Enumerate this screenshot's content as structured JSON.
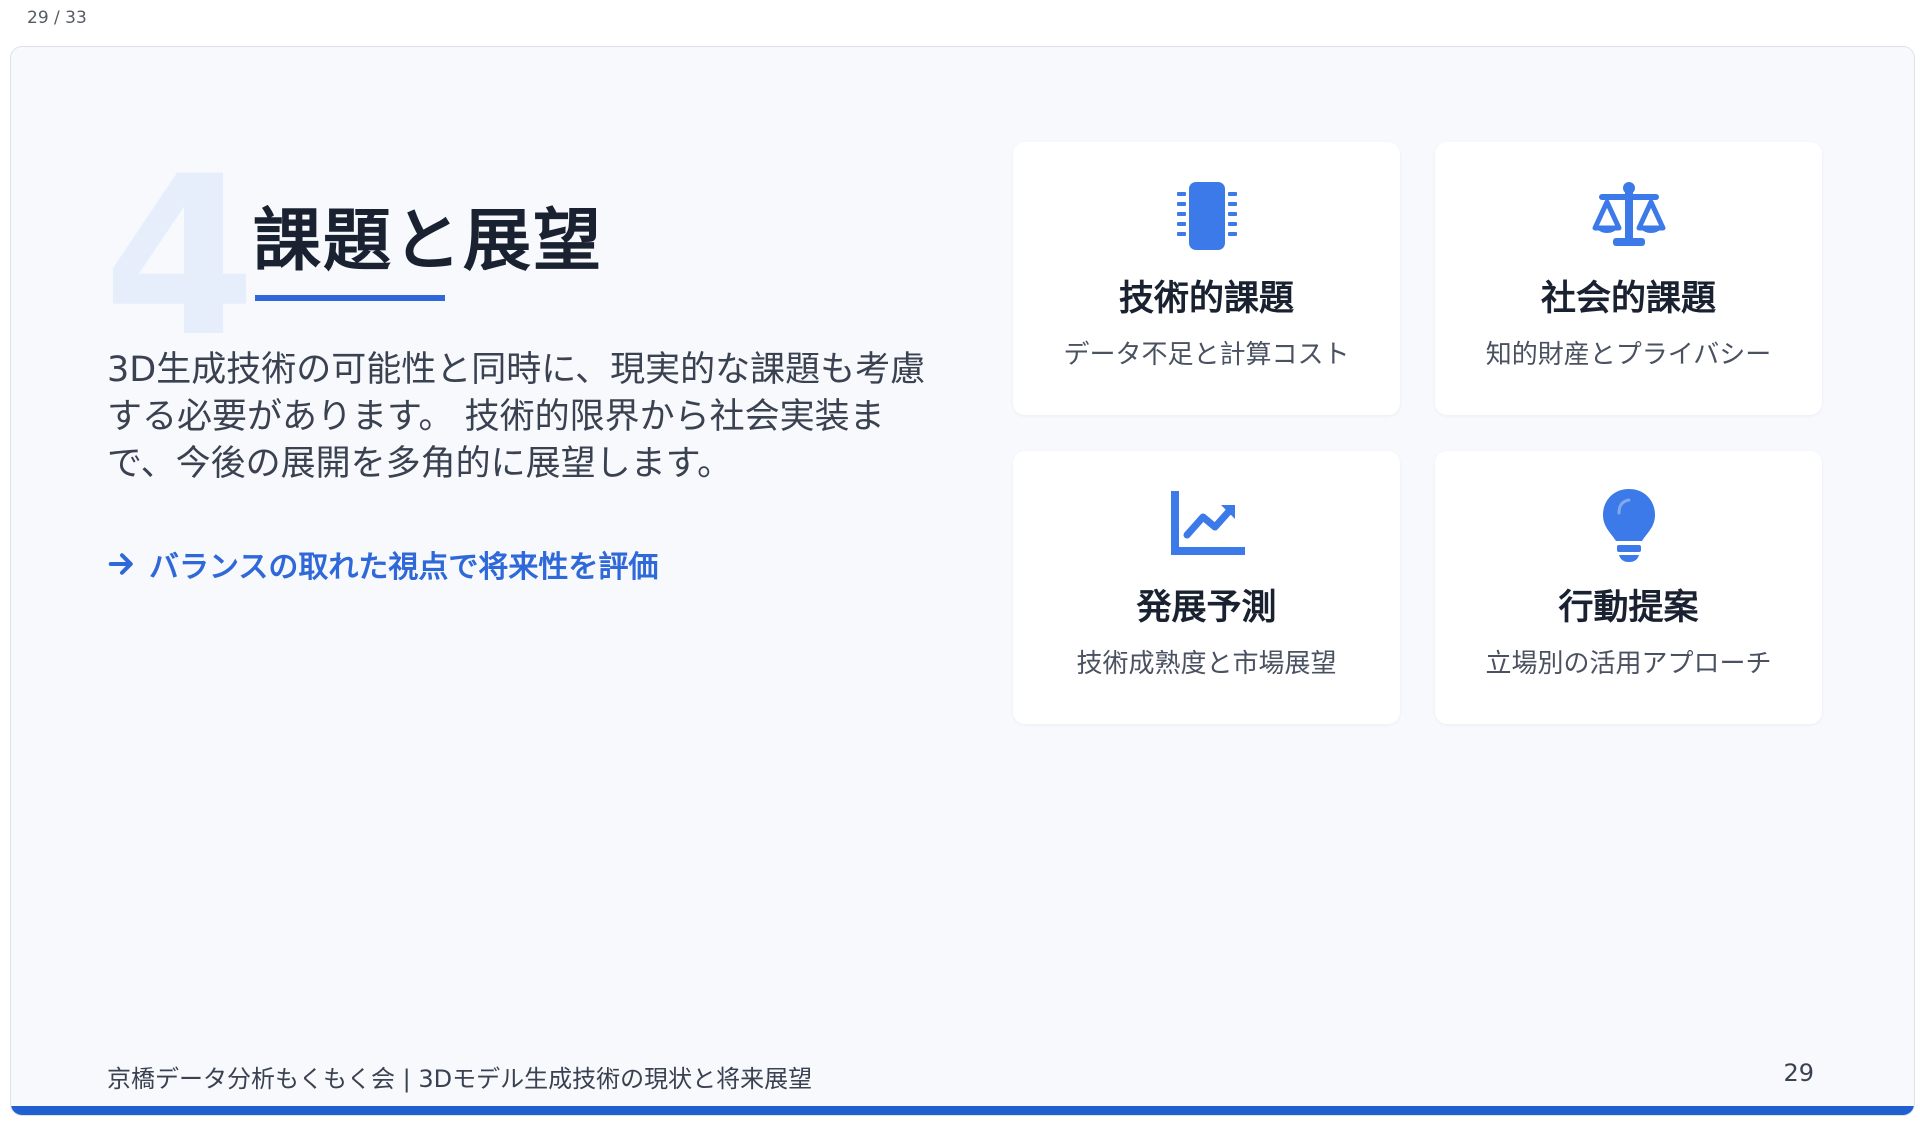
{
  "page_counter": "29 / 33",
  "slide": {
    "section_number": "4",
    "title": "課題と展望",
    "description": "3D生成技術の可能性と同時に、現実的な課題も考慮する必要があります。 技術的限界から社会実装まで、今後の展開を多角的に展望します。",
    "cta": "バランスの取れた視点で将来性を評価",
    "cards": [
      {
        "icon": "chip-icon",
        "title": "技術的課題",
        "subtitle": "データ不足と計算コスト"
      },
      {
        "icon": "scale-icon",
        "title": "社会的課題",
        "subtitle": "知的財産とプライバシー"
      },
      {
        "icon": "trend-chart-icon",
        "title": "発展予測",
        "subtitle": "技術成熟度と市場展望"
      },
      {
        "icon": "lightbulb-icon",
        "title": "行動提案",
        "subtitle": "立場別の活用アプローチ"
      }
    ],
    "footer": "京橋データ分析もくもく会 | 3Dモデル生成技術の現状と将来展望",
    "page_number": "29"
  },
  "colors": {
    "accent": "#2f68d8",
    "icon": "#3b7ae8",
    "title": "#1a2232",
    "background": "#f7f9fd",
    "bottom_bar": "#1f5fd0"
  }
}
